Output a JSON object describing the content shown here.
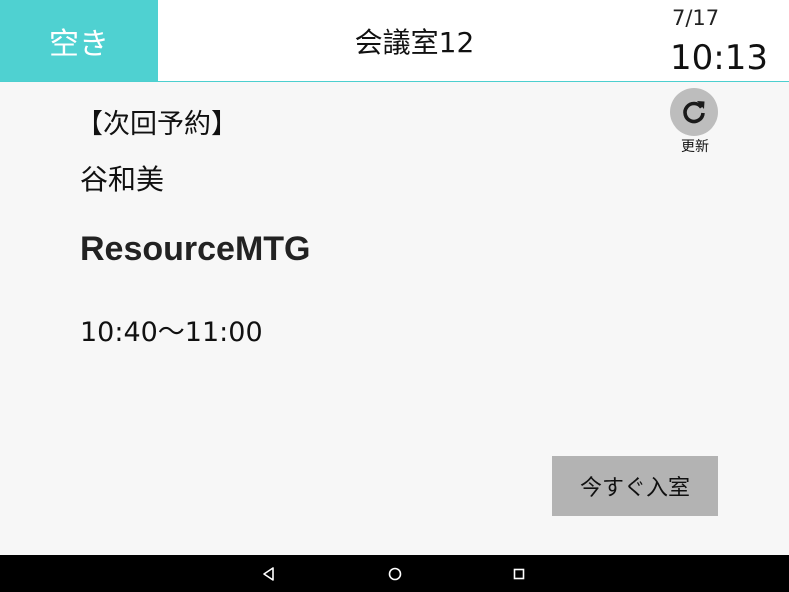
{
  "header": {
    "status": "空き",
    "room_name": "会議室12",
    "date": "7/17",
    "time": "10:13"
  },
  "next_reservation": {
    "heading": "【次回予約】",
    "organizer": "谷和美",
    "title": "ResourceMTG",
    "time_range": "10:40～11:00"
  },
  "refresh": {
    "label": "更新",
    "icon": "refresh-icon"
  },
  "enter_button": {
    "label": "今すぐ入室"
  },
  "navbar": {
    "back_icon": "back-icon",
    "home_icon": "home-icon",
    "recents_icon": "recents-icon"
  },
  "colors": {
    "accent": "#4fd1d1",
    "button_gray": "#b3b3b3",
    "refresh_gray": "#bdbdbd",
    "background": "#f7f7f7"
  }
}
